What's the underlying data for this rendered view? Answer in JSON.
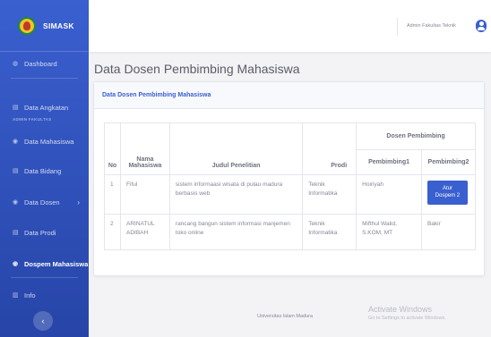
{
  "brand": {
    "name": "SIMASK"
  },
  "sidebar": {
    "dashboard": "Dashboard",
    "heading": "ADMIN FAKULTAS",
    "items": [
      {
        "label": "Data Angkatan",
        "icon": "folder-icon"
      },
      {
        "label": "Data Mahasiswa",
        "icon": "users-icon"
      },
      {
        "label": "Data Bidang",
        "icon": "folder-icon"
      },
      {
        "label": "Data Dosen",
        "icon": "users-icon"
      },
      {
        "label": "Data Prodi",
        "icon": "folder-icon"
      },
      {
        "label": "Dospem Mahasiswa",
        "icon": "users-icon"
      },
      {
        "label": "Info",
        "icon": "file-icon"
      }
    ],
    "collapse_label": "‹"
  },
  "topbar": {
    "user": "Admin Fakultas Teknik"
  },
  "main": {
    "title": "Data Dosen Pembimbing Mahasiswa",
    "card_title": "Data Dosen Pembimbing Mahasiswa",
    "table": {
      "headers": {
        "no": "No",
        "nama": "Nama Mahasiswa",
        "judul": "Judul Penelitian",
        "prodi": "Prodi",
        "dosen_group": "Dosen Pembimbing",
        "p1": "Pembimbing1",
        "p2": "Pembimbing2"
      },
      "rows": [
        {
          "no": "1",
          "nama": "Fiful",
          "judul": "sistem informaasi wisata di pulau madura berbasis web",
          "prodi": "Teknik Informatika",
          "p1": "Hoiriyah",
          "p2_button": "Atur Dospem 2"
        },
        {
          "no": "2",
          "nama": "ARINATUL ADIBAH",
          "judul": "rancang bangun sistem informasi manjemen toko online",
          "prodi": "Teknik Informatika",
          "p1": "Mifthul Walid, S.KOM, MT",
          "p2": "Bakir"
        }
      ]
    }
  },
  "footer": {
    "text": "Universitas Islam Madura",
    "watermark_title": "Activate Windows",
    "watermark_sub": "Go to Settings to activate Windows."
  },
  "colors": {
    "primary": "#3a5fcf",
    "sidebar_dark": "#2745a8",
    "background": "#f3f3f5"
  }
}
